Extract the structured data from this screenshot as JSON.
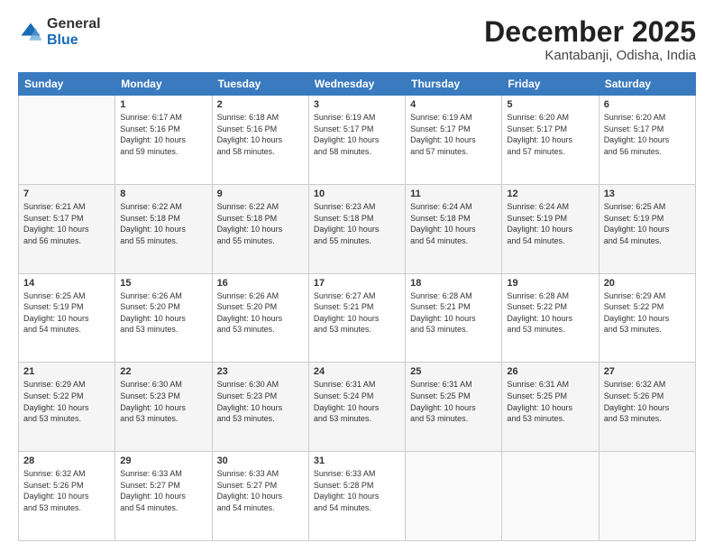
{
  "header": {
    "logo_general": "General",
    "logo_blue": "Blue",
    "month_title": "December 2025",
    "location": "Kantabanji, Odisha, India"
  },
  "days_of_week": [
    "Sunday",
    "Monday",
    "Tuesday",
    "Wednesday",
    "Thursday",
    "Friday",
    "Saturday"
  ],
  "weeks": [
    [
      {
        "day": "",
        "info": ""
      },
      {
        "day": "1",
        "info": "Sunrise: 6:17 AM\nSunset: 5:16 PM\nDaylight: 10 hours\nand 59 minutes."
      },
      {
        "day": "2",
        "info": "Sunrise: 6:18 AM\nSunset: 5:16 PM\nDaylight: 10 hours\nand 58 minutes."
      },
      {
        "day": "3",
        "info": "Sunrise: 6:19 AM\nSunset: 5:17 PM\nDaylight: 10 hours\nand 58 minutes."
      },
      {
        "day": "4",
        "info": "Sunrise: 6:19 AM\nSunset: 5:17 PM\nDaylight: 10 hours\nand 57 minutes."
      },
      {
        "day": "5",
        "info": "Sunrise: 6:20 AM\nSunset: 5:17 PM\nDaylight: 10 hours\nand 57 minutes."
      },
      {
        "day": "6",
        "info": "Sunrise: 6:20 AM\nSunset: 5:17 PM\nDaylight: 10 hours\nand 56 minutes."
      }
    ],
    [
      {
        "day": "7",
        "info": "Sunrise: 6:21 AM\nSunset: 5:17 PM\nDaylight: 10 hours\nand 56 minutes."
      },
      {
        "day": "8",
        "info": "Sunrise: 6:22 AM\nSunset: 5:18 PM\nDaylight: 10 hours\nand 55 minutes."
      },
      {
        "day": "9",
        "info": "Sunrise: 6:22 AM\nSunset: 5:18 PM\nDaylight: 10 hours\nand 55 minutes."
      },
      {
        "day": "10",
        "info": "Sunrise: 6:23 AM\nSunset: 5:18 PM\nDaylight: 10 hours\nand 55 minutes."
      },
      {
        "day": "11",
        "info": "Sunrise: 6:24 AM\nSunset: 5:18 PM\nDaylight: 10 hours\nand 54 minutes."
      },
      {
        "day": "12",
        "info": "Sunrise: 6:24 AM\nSunset: 5:19 PM\nDaylight: 10 hours\nand 54 minutes."
      },
      {
        "day": "13",
        "info": "Sunrise: 6:25 AM\nSunset: 5:19 PM\nDaylight: 10 hours\nand 54 minutes."
      }
    ],
    [
      {
        "day": "14",
        "info": "Sunrise: 6:25 AM\nSunset: 5:19 PM\nDaylight: 10 hours\nand 54 minutes."
      },
      {
        "day": "15",
        "info": "Sunrise: 6:26 AM\nSunset: 5:20 PM\nDaylight: 10 hours\nand 53 minutes."
      },
      {
        "day": "16",
        "info": "Sunrise: 6:26 AM\nSunset: 5:20 PM\nDaylight: 10 hours\nand 53 minutes."
      },
      {
        "day": "17",
        "info": "Sunrise: 6:27 AM\nSunset: 5:21 PM\nDaylight: 10 hours\nand 53 minutes."
      },
      {
        "day": "18",
        "info": "Sunrise: 6:28 AM\nSunset: 5:21 PM\nDaylight: 10 hours\nand 53 minutes."
      },
      {
        "day": "19",
        "info": "Sunrise: 6:28 AM\nSunset: 5:22 PM\nDaylight: 10 hours\nand 53 minutes."
      },
      {
        "day": "20",
        "info": "Sunrise: 6:29 AM\nSunset: 5:22 PM\nDaylight: 10 hours\nand 53 minutes."
      }
    ],
    [
      {
        "day": "21",
        "info": "Sunrise: 6:29 AM\nSunset: 5:22 PM\nDaylight: 10 hours\nand 53 minutes."
      },
      {
        "day": "22",
        "info": "Sunrise: 6:30 AM\nSunset: 5:23 PM\nDaylight: 10 hours\nand 53 minutes."
      },
      {
        "day": "23",
        "info": "Sunrise: 6:30 AM\nSunset: 5:23 PM\nDaylight: 10 hours\nand 53 minutes."
      },
      {
        "day": "24",
        "info": "Sunrise: 6:31 AM\nSunset: 5:24 PM\nDaylight: 10 hours\nand 53 minutes."
      },
      {
        "day": "25",
        "info": "Sunrise: 6:31 AM\nSunset: 5:25 PM\nDaylight: 10 hours\nand 53 minutes."
      },
      {
        "day": "26",
        "info": "Sunrise: 6:31 AM\nSunset: 5:25 PM\nDaylight: 10 hours\nand 53 minutes."
      },
      {
        "day": "27",
        "info": "Sunrise: 6:32 AM\nSunset: 5:26 PM\nDaylight: 10 hours\nand 53 minutes."
      }
    ],
    [
      {
        "day": "28",
        "info": "Sunrise: 6:32 AM\nSunset: 5:26 PM\nDaylight: 10 hours\nand 53 minutes."
      },
      {
        "day": "29",
        "info": "Sunrise: 6:33 AM\nSunset: 5:27 PM\nDaylight: 10 hours\nand 54 minutes."
      },
      {
        "day": "30",
        "info": "Sunrise: 6:33 AM\nSunset: 5:27 PM\nDaylight: 10 hours\nand 54 minutes."
      },
      {
        "day": "31",
        "info": "Sunrise: 6:33 AM\nSunset: 5:28 PM\nDaylight: 10 hours\nand 54 minutes."
      },
      {
        "day": "",
        "info": ""
      },
      {
        "day": "",
        "info": ""
      },
      {
        "day": "",
        "info": ""
      }
    ]
  ]
}
